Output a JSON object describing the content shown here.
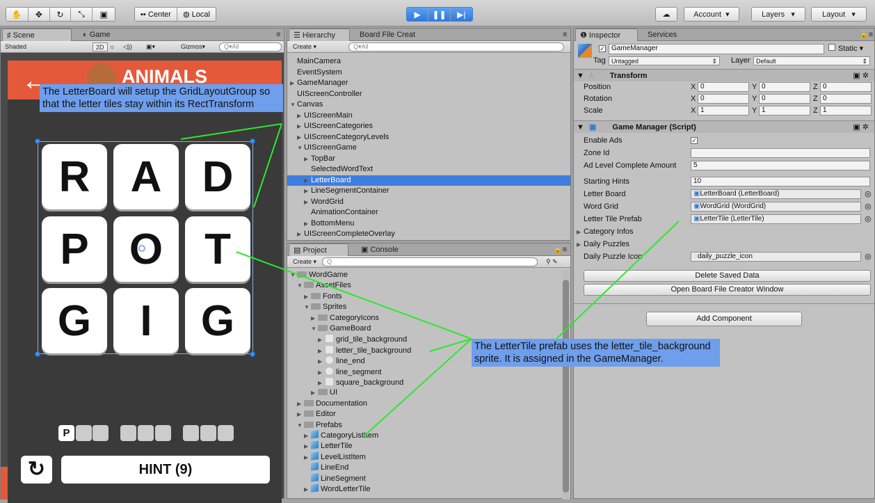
{
  "toolbar": {
    "tools": [
      "hand-tool",
      "move-tool",
      "rotate-tool",
      "scale-tool",
      "rect-tool"
    ],
    "pivot_label": "Center",
    "space_label": "Local",
    "play_controls": [
      "play",
      "pause",
      "step"
    ],
    "account_label": "Account",
    "layers_label": "Layers",
    "layout_label": "Layout"
  },
  "scene_panel": {
    "tabs": [
      "Scene",
      "Game"
    ],
    "shading": "Shaded",
    "mode_2d": "2D",
    "gizmos_label": "Gizmos",
    "search_placeholder": "Q▾All"
  },
  "game_view": {
    "header_title": "ANIMALS",
    "letters": [
      "R",
      "A",
      "D",
      "P",
      "O",
      "T",
      "G",
      "I",
      "G"
    ],
    "word_first_letter": "P",
    "hint_label": "HINT (9)",
    "header_color": "#e4593a"
  },
  "hierarchy": {
    "tabs": [
      "Hierarchy",
      "Board File Creat"
    ],
    "create_label": "Create",
    "search_placeholder": "Q▾All",
    "items": [
      {
        "label": "MainCamera",
        "indent": 0,
        "arrow": ""
      },
      {
        "label": "EventSystem",
        "indent": 0,
        "arrow": ""
      },
      {
        "label": "GameManager",
        "indent": 0,
        "arrow": "▶"
      },
      {
        "label": "UIScreenController",
        "indent": 0,
        "arrow": ""
      },
      {
        "label": "Canvas",
        "indent": 0,
        "arrow": "▼"
      },
      {
        "label": "UIScreenMain",
        "indent": 1,
        "arrow": "▶"
      },
      {
        "label": "UIScreenCategories",
        "indent": 1,
        "arrow": "▶"
      },
      {
        "label": "UIScreenCategoryLevels",
        "indent": 1,
        "arrow": "▶"
      },
      {
        "label": "UIScreenGame",
        "indent": 1,
        "arrow": "▼"
      },
      {
        "label": "TopBar",
        "indent": 2,
        "arrow": "▶"
      },
      {
        "label": "SelectedWordText",
        "indent": 2,
        "arrow": ""
      },
      {
        "label": "LetterBoard",
        "indent": 2,
        "arrow": "▶",
        "selected": true
      },
      {
        "label": "LineSegmentContainer",
        "indent": 2,
        "arrow": "▶"
      },
      {
        "label": "WordGrid",
        "indent": 2,
        "arrow": "▶"
      },
      {
        "label": "AnimationContainer",
        "indent": 2,
        "arrow": ""
      },
      {
        "label": "BottomMenu",
        "indent": 2,
        "arrow": "▶"
      },
      {
        "label": "UIScreenCompleteOverlay",
        "indent": 1,
        "arrow": "▶"
      }
    ]
  },
  "project": {
    "tabs": [
      "Project",
      "Console"
    ],
    "create_label": "Create",
    "items": [
      {
        "label": "WordGame",
        "indent": 0,
        "arrow": "▼",
        "icon": "folder"
      },
      {
        "label": "AssetFiles",
        "indent": 1,
        "arrow": "▼",
        "icon": "folder"
      },
      {
        "label": "Fonts",
        "indent": 2,
        "arrow": "▶",
        "icon": "folder"
      },
      {
        "label": "Sprites",
        "indent": 2,
        "arrow": "▼",
        "icon": "folder"
      },
      {
        "label": "CategoryIcons",
        "indent": 3,
        "arrow": "▶",
        "icon": "folder"
      },
      {
        "label": "GameBoard",
        "indent": 3,
        "arrow": "▼",
        "icon": "folder"
      },
      {
        "label": "grid_tile_background",
        "indent": 4,
        "arrow": "▶",
        "icon": "sprite"
      },
      {
        "label": "letter_tile_background",
        "indent": 4,
        "arrow": "▶",
        "icon": "sprite"
      },
      {
        "label": "line_end",
        "indent": 4,
        "arrow": "▶",
        "icon": "circle"
      },
      {
        "label": "line_segment",
        "indent": 4,
        "arrow": "▶",
        "icon": "circle"
      },
      {
        "label": "square_background",
        "indent": 4,
        "arrow": "▶",
        "icon": "sprite"
      },
      {
        "label": "UI",
        "indent": 3,
        "arrow": "▶",
        "icon": "folder"
      },
      {
        "label": "Documentation",
        "indent": 1,
        "arrow": "▶",
        "icon": "folder"
      },
      {
        "label": "Editor",
        "indent": 1,
        "arrow": "▶",
        "icon": "folder"
      },
      {
        "label": "Prefabs",
        "indent": 1,
        "arrow": "▼",
        "icon": "folder"
      },
      {
        "label": "CategoryListItem",
        "indent": 2,
        "arrow": "▶",
        "icon": "prefab"
      },
      {
        "label": "LetterTile",
        "indent": 2,
        "arrow": "▶",
        "icon": "prefab"
      },
      {
        "label": "LevelListItem",
        "indent": 2,
        "arrow": "▶",
        "icon": "prefab"
      },
      {
        "label": "LineEnd",
        "indent": 2,
        "arrow": "",
        "icon": "prefab"
      },
      {
        "label": "LineSegment",
        "indent": 2,
        "arrow": "",
        "icon": "prefab"
      },
      {
        "label": "WordLetterTile",
        "indent": 2,
        "arrow": "▶",
        "icon": "prefab"
      }
    ]
  },
  "inspector": {
    "tabs": [
      "Inspector",
      "Services"
    ],
    "object_name": "GameManager",
    "static_label": "Static",
    "tag_label": "Tag",
    "tag_value": "Untagged",
    "layer_label": "Layer",
    "layer_value": "Default",
    "transform": {
      "title": "Transform",
      "rows": [
        {
          "label": "Position",
          "x": "0",
          "y": "0",
          "z": "0"
        },
        {
          "label": "Rotation",
          "x": "0",
          "y": "0",
          "z": "0"
        },
        {
          "label": "Scale",
          "x": "1",
          "y": "1",
          "z": "1"
        }
      ]
    },
    "script": {
      "title": "Game Manager (Script)",
      "enable_ads_label": "Enable Ads",
      "zone_id_label": "Zone Id",
      "zone_id_value": "",
      "ad_level_label": "Ad Level Complete Amount",
      "ad_level_value": "5",
      "starting_hints_label": "Starting Hints",
      "starting_hints_value": "10",
      "letter_board_label": "Letter Board",
      "letter_board_value": "LetterBoard (LetterBoard)",
      "word_grid_label": "Word Grid",
      "word_grid_value": "WordGrid (WordGrid)",
      "letter_tile_label": "Letter Tile Prefab",
      "letter_tile_value": "LetterTile (LetterTile)",
      "category_infos_label": "Category Infos",
      "daily_puzzles_label": "Daily Puzzles",
      "daily_icon_label": "Daily Puzzle Icon",
      "daily_icon_value": "daily_puzzle_icon"
    },
    "delete_button": "Delete Saved Data",
    "open_creator_button": "Open Board File Creator Window",
    "add_component_button": "Add Component"
  },
  "callouts": {
    "letterboard": "The LetterBoard will setup the GridLayoutGroup so that the letter tiles stay within its RectTransform",
    "lettertile": "The LetterTile prefab uses the letter_tile_background sprite. It is assigned in the GameManager."
  }
}
